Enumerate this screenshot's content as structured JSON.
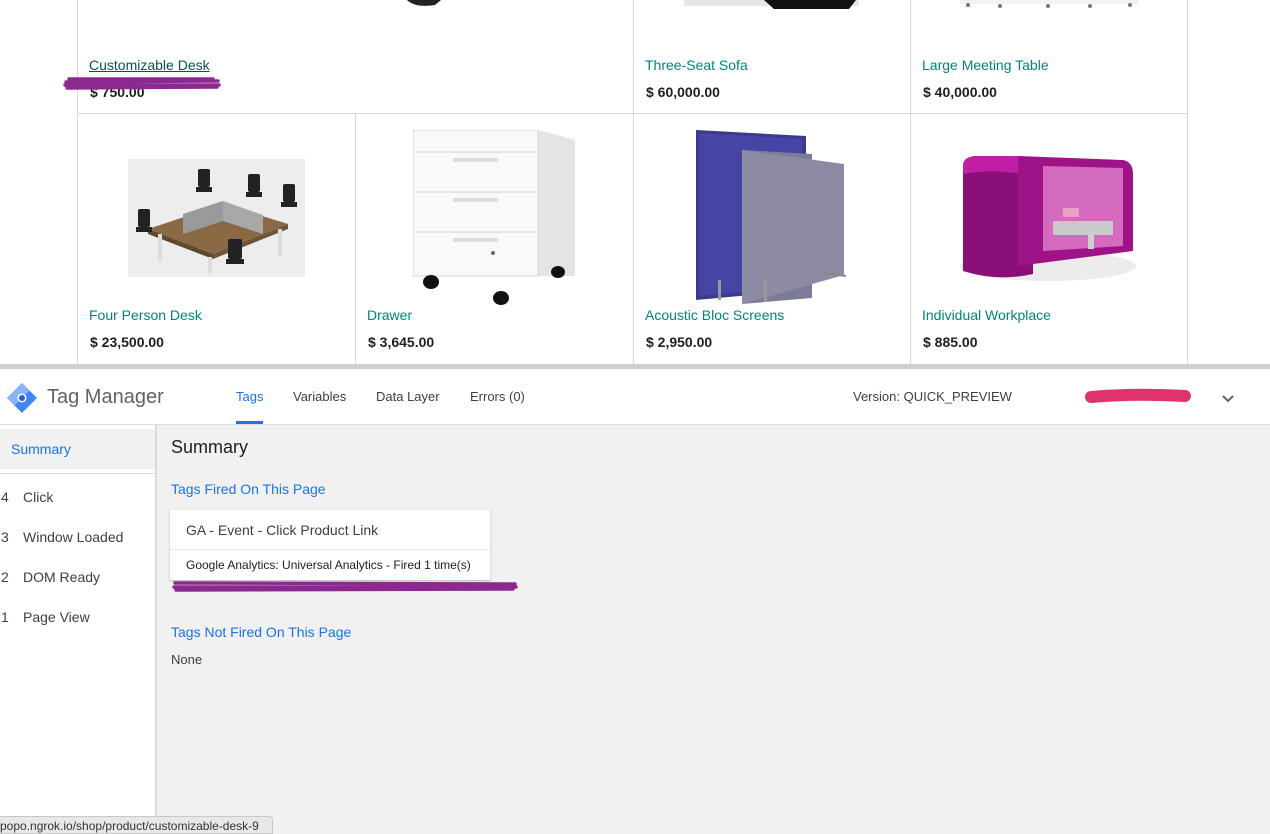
{
  "shop": {
    "products_row1": [
      {
        "name": "Customizable Desk",
        "price": "$ 750.00"
      },
      {
        "name": "Three-Seat Sofa",
        "price": "$ 60,000.00"
      },
      {
        "name": "Large Meeting Table",
        "price": "$ 40,000.00"
      }
    ],
    "products_row2": [
      {
        "name": "Four Person Desk",
        "price": "$ 23,500.00"
      },
      {
        "name": "Drawer",
        "price": "$ 3,645.00"
      },
      {
        "name": "Acoustic Bloc Screens",
        "price": "$ 2,950.00"
      },
      {
        "name": "Individual Workplace",
        "price": "$ 885.00"
      }
    ],
    "colors": {
      "link": "#00857c",
      "visited_link": "#0b4f57",
      "redaction_purple": "#8a2a8f",
      "redaction_pink": "#e0336e"
    }
  },
  "gtm": {
    "title": "Tag Manager",
    "tabs": [
      "Tags",
      "Variables",
      "Data Layer",
      "Errors (0)"
    ],
    "active_tab": "Tags",
    "version": "Version: QUICK_PREVIEW",
    "sidebar": {
      "summary_label": "Summary",
      "events": [
        {
          "num": "4",
          "label": "Click"
        },
        {
          "num": "3",
          "label": "Window Loaded"
        },
        {
          "num": "2",
          "label": "DOM Ready"
        },
        {
          "num": "1",
          "label": "Page View"
        }
      ]
    },
    "main": {
      "title": "Summary",
      "fired_title": "Tags Fired On This Page",
      "fired_tag": {
        "name": "GA - Event - Click Product Link",
        "detail": "Google Analytics: Universal Analytics - Fired 1 time(s)"
      },
      "not_fired_title": "Tags Not Fired On This Page",
      "not_fired_value": "None"
    },
    "accent": "#1a73e8"
  },
  "status_bar": {
    "url": "popo.ngrok.io/shop/product/customizable-desk-9"
  }
}
